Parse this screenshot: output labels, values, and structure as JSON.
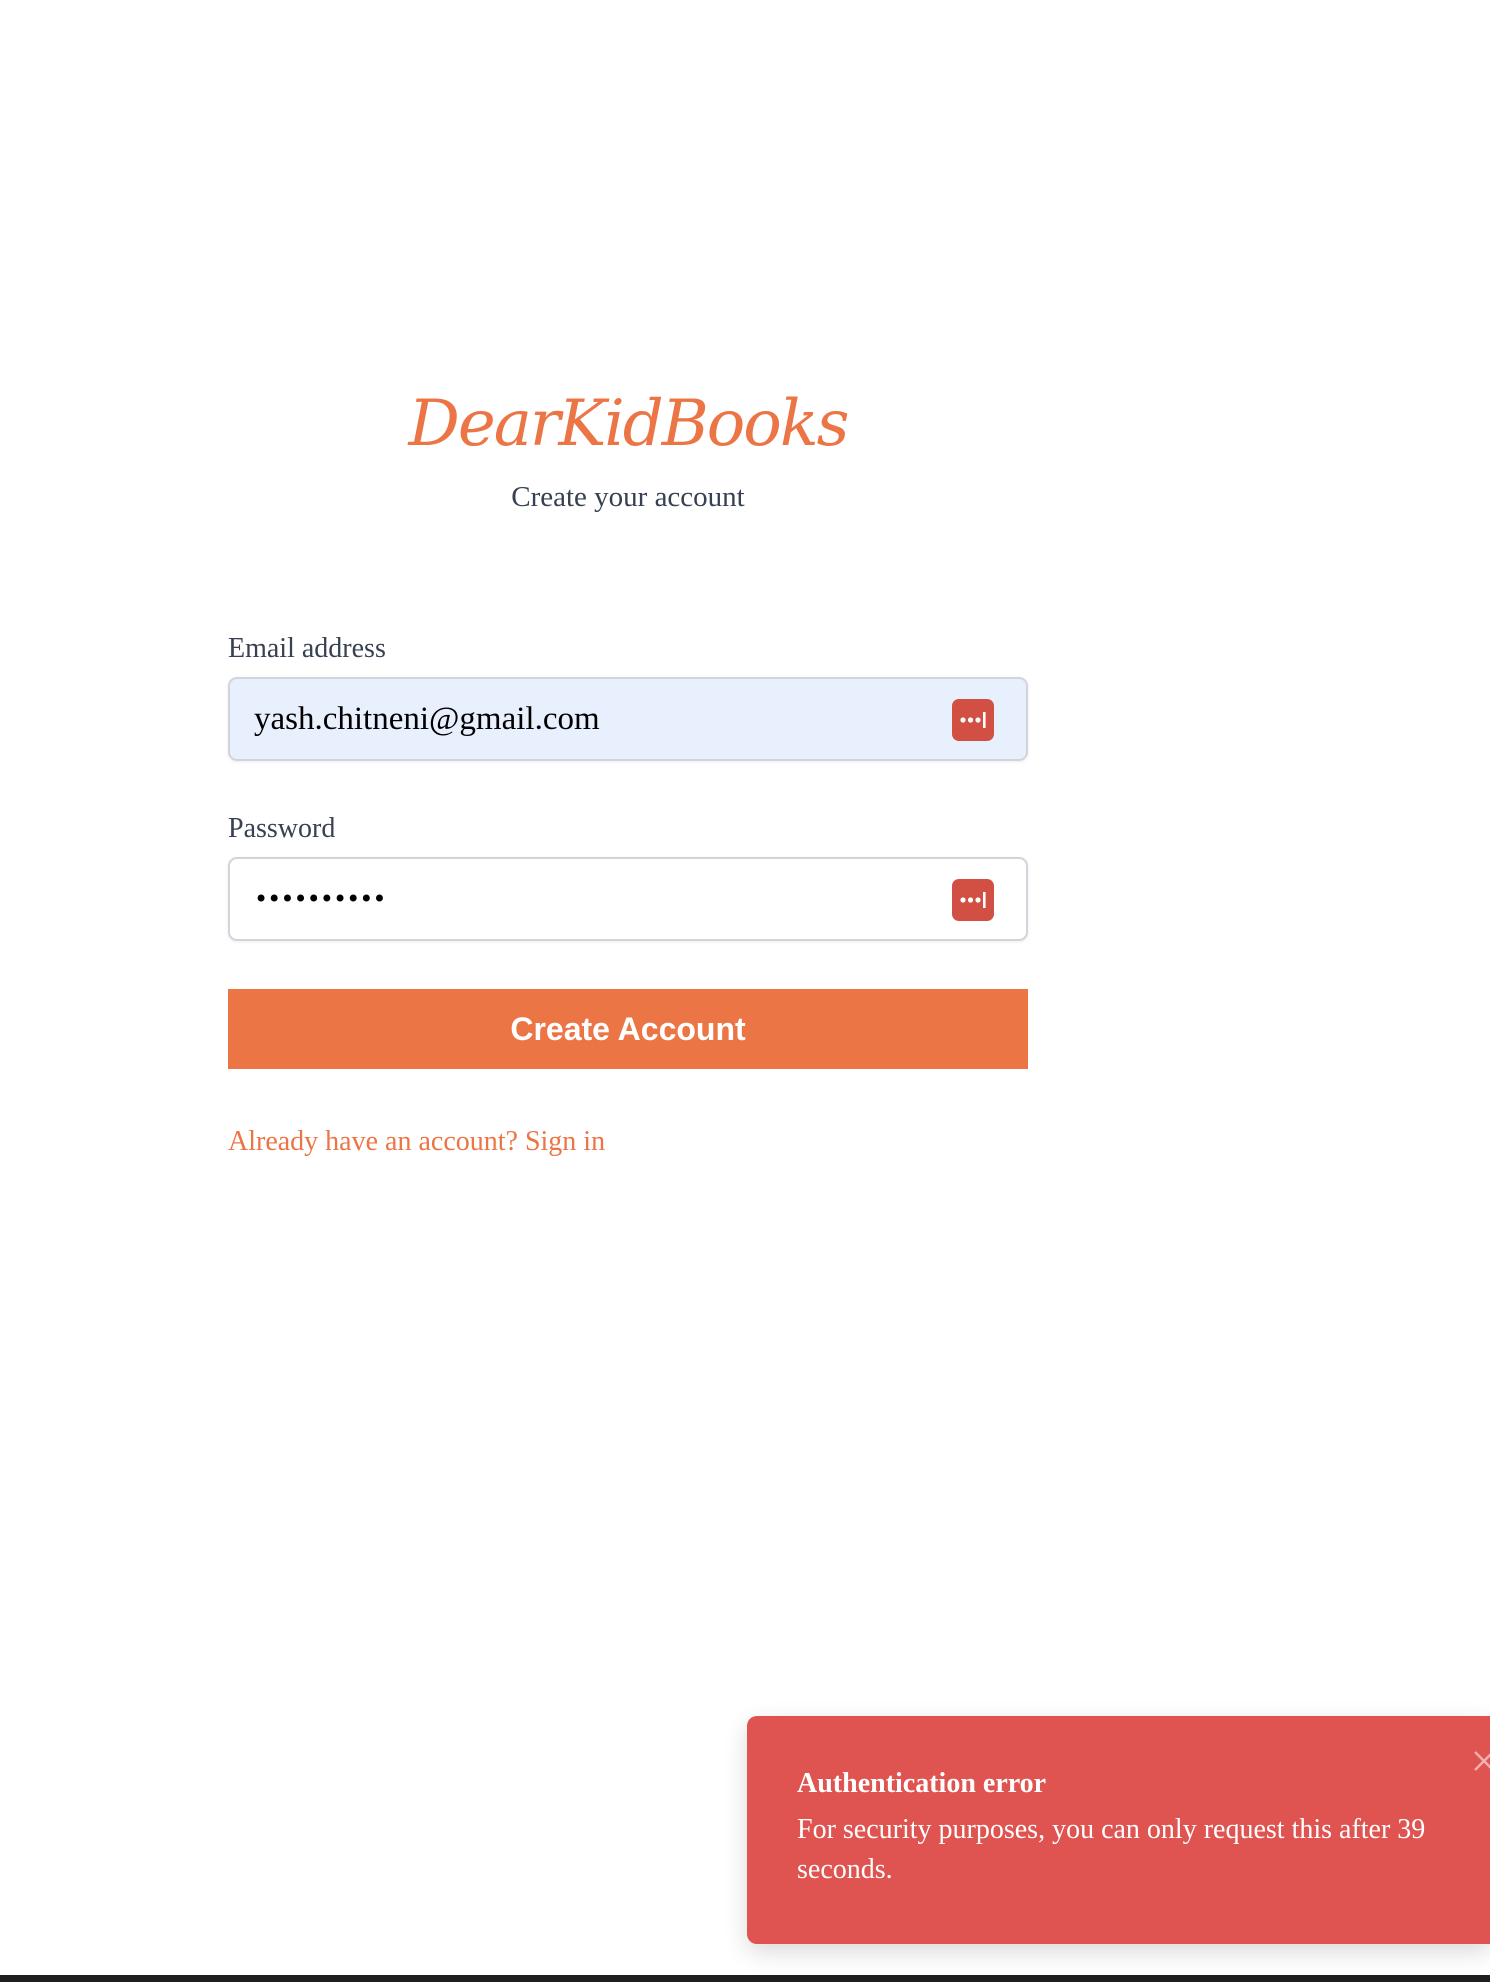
{
  "brand": {
    "logo_text": "DearKidBooks"
  },
  "page": {
    "subtitle": "Create your account"
  },
  "form": {
    "email": {
      "label": "Email address",
      "value": "yash.chitneni@gmail.com",
      "autofill_icon": "password-manager-icon"
    },
    "password": {
      "label": "Password",
      "value_masked": "••••••••••",
      "autofill_icon": "password-manager-icon"
    },
    "submit_label": "Create Account",
    "signin_link": "Already have an account? Sign in"
  },
  "toast": {
    "title": "Authentication error",
    "message": "For security purposes, you can only request this after 39 seconds.",
    "close_icon": "close-icon"
  },
  "colors": {
    "accent": "#ec7546",
    "error": "#df5350",
    "autofill_bg": "#e8effd",
    "password_manager": "#d14f43",
    "text_muted": "#374151"
  }
}
